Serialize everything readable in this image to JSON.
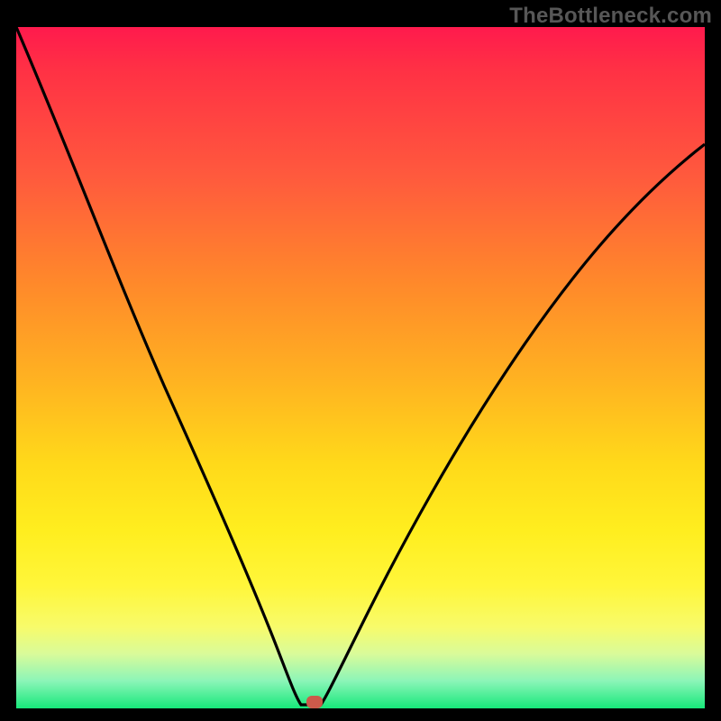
{
  "watermark": "TheBottleneck.com",
  "colors": {
    "frame_background": "#000000",
    "gradient_top": "#ff1a4d",
    "gradient_bottom": "#17e87a",
    "curve": "#000000",
    "minimum_dot": "#cc5a4a",
    "watermark_text": "#575757"
  },
  "chart_data": {
    "type": "line",
    "title": "",
    "xlabel": "",
    "ylabel": "",
    "xlim": [
      0,
      100
    ],
    "ylim": [
      0,
      100
    ],
    "grid": false,
    "axes_visible": false,
    "description": "V-shaped bottleneck curve on a vertical red-to-green heat gradient background. Curve decreases steeply from top-left to a flat minimum near x≈43, then rises toward upper right. Minimum region marked with a small rounded red rectangle.",
    "series": [
      {
        "name": "bottleneck-curve",
        "x": [
          0,
          5,
          10,
          15,
          20,
          25,
          30,
          35,
          38,
          40,
          42,
          43,
          45,
          48,
          52,
          58,
          65,
          72,
          80,
          88,
          95,
          100
        ],
        "y": [
          100,
          87,
          74,
          62,
          50,
          39,
          28,
          17,
          9,
          4,
          1,
          0,
          0.5,
          3,
          8,
          17,
          29,
          41,
          53,
          64,
          73,
          79
        ]
      }
    ],
    "minimum_marker": {
      "x": 43.2,
      "y": 0
    }
  }
}
